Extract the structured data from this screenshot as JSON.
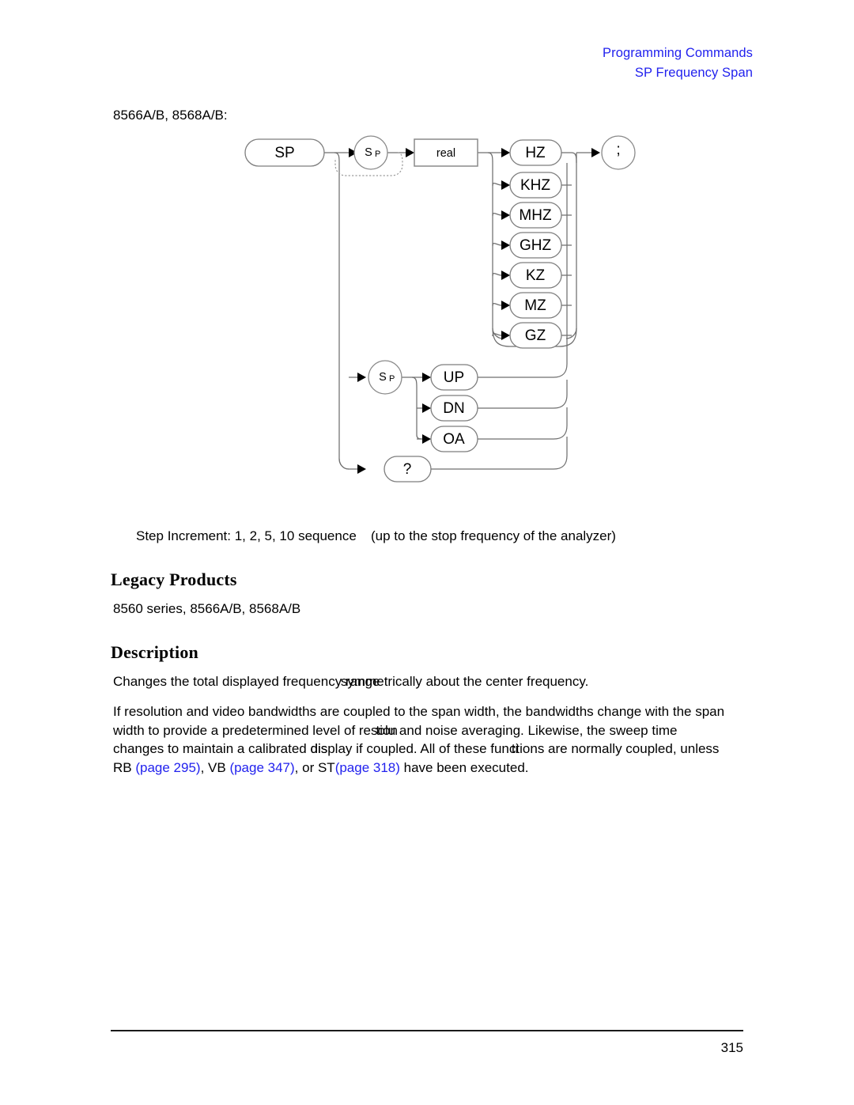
{
  "header": {
    "line1": "Programming Commands",
    "line2": "SP Frequency Span"
  },
  "models_caption": "8566A/B, 8568A/B:",
  "diagram": {
    "start_label": "SP",
    "token_sp_upper": "S",
    "token_sp_upper_sub": "P",
    "operand_label": "real",
    "units": [
      "HZ",
      "KHZ",
      "MHZ",
      "GHZ",
      "KZ",
      "MZ",
      "GZ"
    ],
    "token_sp_lower": "S",
    "token_sp_lower_sub": "P",
    "step_commands": [
      "UP",
      "DN",
      "OA"
    ],
    "query_label": "?",
    "terminator_label": ";"
  },
  "step_increment": {
    "part_a": "Step Increment: 1, 2, 5, 10 sequence",
    "part_b": "(up to the stop frequency of the analyzer)"
  },
  "headings": {
    "legacy_products": "Legacy Products",
    "description": "Description"
  },
  "legacy_products_list": "8560 series, 8566A/B, 8568A/B",
  "description": {
    "para1_a": "Changes the total displayed frequency ",
    "para1_b": "range",
    "para1_c": "symmetrically about the center frequency.",
    "para2_line1": "If resolution and video bandwidths are coupled to the span width, the bandwidths change with the span",
    "para2_line2_a": "width to provide a predetermined level of res",
    "para2_line2_b": "olu",
    "para2_line2_c": "tion",
    "para2_line2_d": " and noise averaging. Likewise, the sweep time",
    "para2_line3_a": "changes to maintain a calibrated ",
    "para2_line3_b": "display",
    "para2_line3_c": "dis",
    "para2_line3_d": " if coupled. All of these fun",
    "para2_line3_e": "ctio",
    "para2_line3_f": "ti",
    "para2_line3_g": "ns are normally coupled, unless",
    "para2_line4_rb": "RB ",
    "para2_line4_ref1": "(page 295)",
    "para2_line4_sep1": ", ",
    "para2_line4_vb": "VB ",
    "para2_line4_ref2": "(page 347)",
    "para2_line4_sep2": ", ",
    "para2_line4_or": "or ST",
    "para2_line4_ref3": "(page 318)",
    "para2_line4_tail": " have been executed."
  },
  "footer": {
    "page_number": "315"
  },
  "colors": {
    "link_blue": "#2222ee",
    "wire_gray": "#6f6f6f"
  }
}
